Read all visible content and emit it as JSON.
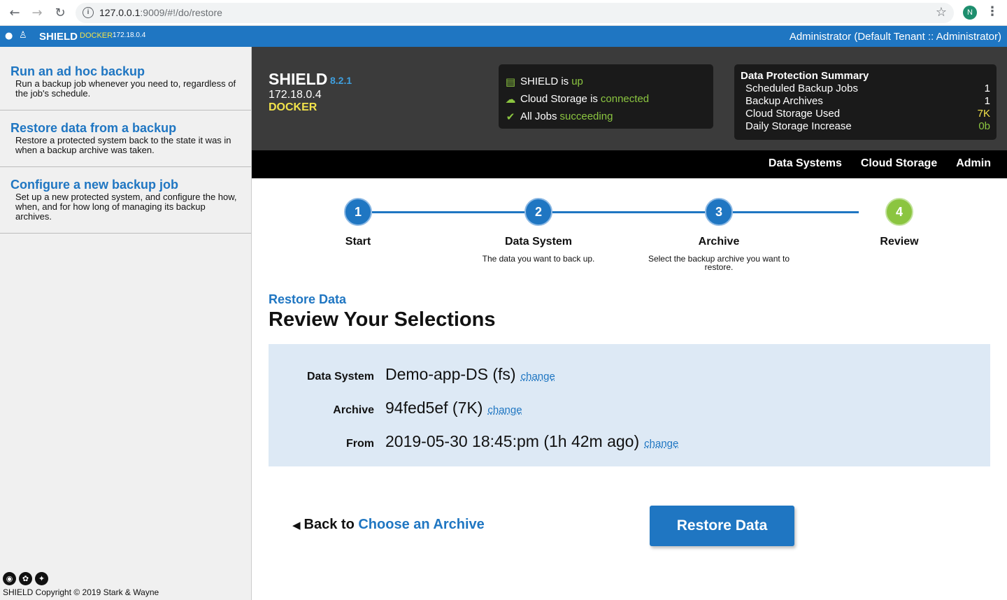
{
  "browser": {
    "url_host": "127.0.0.1",
    "url_rest": ":9009/#!/do/restore",
    "profile_initial": "N"
  },
  "topbar": {
    "brand": "SHIELD",
    "env": "DOCKER",
    "ip": "172.18.0.4",
    "user": "Administrator (Default Tenant :: Administrator)"
  },
  "sidebar": {
    "items": [
      {
        "title": "Run an ad hoc backup",
        "desc": "Run a backup job whenever you need to, regardless of the job's schedule."
      },
      {
        "title": "Restore data from a backup",
        "desc": "Restore a protected system back to the state it was in when a backup archive was taken."
      },
      {
        "title": "Configure a new backup job",
        "desc": "Set up a new protected system, and configure the how, when, and for how long of managing its backup archives."
      }
    ],
    "copyright": "SHIELD Copyright © 2019 Stark & Wayne"
  },
  "hero": {
    "name": "SHIELD",
    "version": "8.2.1",
    "ip": "172.18.0.4",
    "env": "DOCKER"
  },
  "status": [
    {
      "label": "SHIELD is",
      "value": "up",
      "icon": "server-check-icon"
    },
    {
      "label": "Cloud Storage is",
      "value": "connected",
      "icon": "cloud-check-icon"
    },
    {
      "label": "All Jobs",
      "value": "succeeding",
      "icon": "check-badge-icon"
    }
  ],
  "summary": {
    "title": "Data Protection Summary",
    "rows": [
      {
        "label": "Scheduled Backup Jobs",
        "value": "1"
      },
      {
        "label": "Backup Archives",
        "value": "1"
      },
      {
        "label": "Cloud Storage Used",
        "value": "7K"
      },
      {
        "label": "Daily Storage Increase",
        "value": "0b"
      }
    ]
  },
  "nav": [
    "Data Systems",
    "Cloud Storage",
    "Admin"
  ],
  "steps": [
    {
      "num": "1",
      "label": "Start",
      "desc": ""
    },
    {
      "num": "2",
      "label": "Data System",
      "desc": "The data you want to back up."
    },
    {
      "num": "3",
      "label": "Archive",
      "desc": "Select the backup archive you want to restore."
    },
    {
      "num": "4",
      "label": "Review",
      "desc": ""
    }
  ],
  "content": {
    "kicker": "Restore Data",
    "heading": "Review Your Selections",
    "rows": [
      {
        "label": "Data System",
        "value": "Demo-app-DS (fs)",
        "change": "change"
      },
      {
        "label": "Archive",
        "value": "94fed5ef (7K)",
        "change": "change"
      },
      {
        "label": "From",
        "value": "2019-05-30 18:45:pm (1h 42m ago)",
        "change": "change"
      }
    ],
    "back_prefix": "Back to",
    "back_link": "Choose an Archive",
    "restore_button": "Restore Data"
  },
  "colors": {
    "brand_blue": "#1f76c2",
    "ok_green": "#8bc540",
    "env_yellow": "#f2e34b"
  }
}
